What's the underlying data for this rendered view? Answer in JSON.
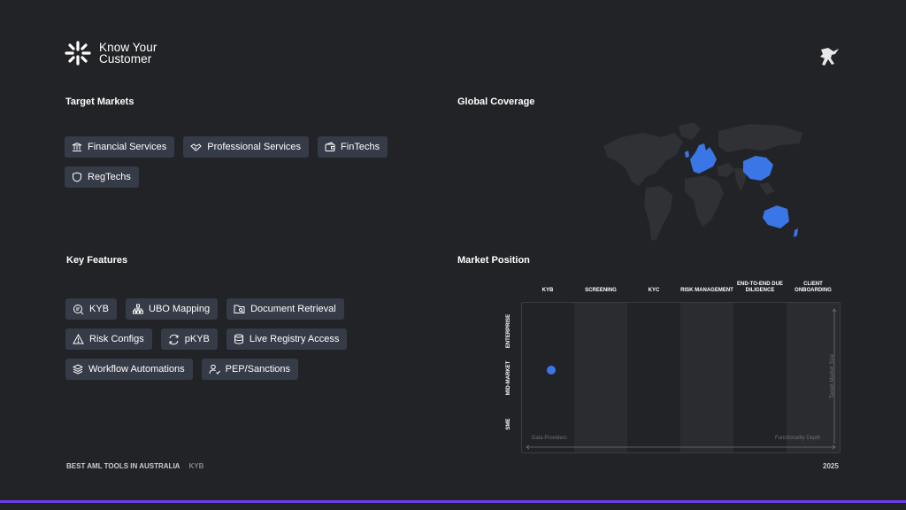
{
  "brand": {
    "name_line1": "Know Your",
    "name_line2": "Customer"
  },
  "target_markets": {
    "title": "Target Markets",
    "items": [
      {
        "label": "Financial Services",
        "icon": "bank-icon"
      },
      {
        "label": "Professional Services",
        "icon": "handshake-icon"
      },
      {
        "label": "FinTechs",
        "icon": "wallet-icon"
      },
      {
        "label": "RegTechs",
        "icon": "shield-icon"
      }
    ]
  },
  "global_coverage": {
    "title": "Global Coverage",
    "highlighted_regions": [
      "Europe",
      "China",
      "Australia"
    ],
    "highlight_color": "#3b76e6"
  },
  "key_features": {
    "title": "Key Features",
    "items": [
      {
        "label": "KYB",
        "icon": "search-doc-icon"
      },
      {
        "label": "UBO Mapping",
        "icon": "hierarchy-icon"
      },
      {
        "label": "Document Retrieval",
        "icon": "folder-icon"
      },
      {
        "label": "Risk Configs",
        "icon": "warning-icon"
      },
      {
        "label": "pKYB",
        "icon": "refresh-icon"
      },
      {
        "label": "Live Registry Access",
        "icon": "database-icon"
      },
      {
        "label": "Workflow Automations",
        "icon": "layers-icon"
      },
      {
        "label": "PEP/Sanctions",
        "icon": "user-check-icon"
      }
    ]
  },
  "market_position": {
    "title": "Market Position",
    "columns": [
      "KYB",
      "SCREENING",
      "KYC",
      "RISK MANAGEMENT",
      "END-TO-END DUE DILIGENCE",
      "CLIENT ONBOARDING"
    ],
    "rows": [
      "ENTERPRISE",
      "MID-MARKET",
      "SME"
    ],
    "x_axis_start": "Data Providers",
    "x_axis_end": "Functionality Depth",
    "y_axis": "Target Market Size",
    "marker": {
      "column": "KYB",
      "row": "MID-MARKET",
      "color": "#3b76e6"
    }
  },
  "footer": {
    "title": "BEST AML TOOLS IN AUSTRALIA",
    "tag": "KYB",
    "year": "2025"
  },
  "accent_color": "#6d3ce8"
}
